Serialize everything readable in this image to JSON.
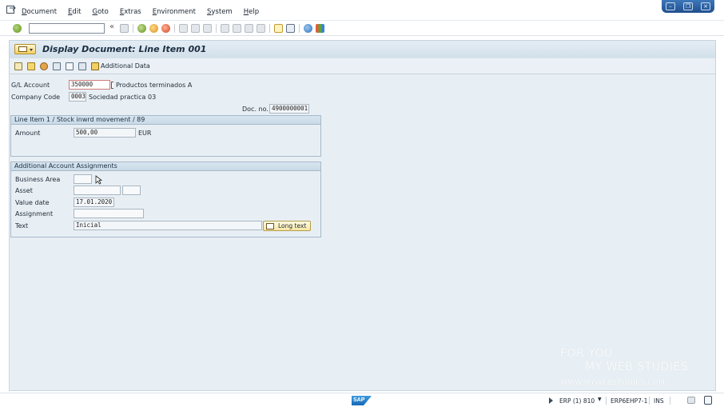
{
  "menu": {
    "items": [
      "Document",
      "Edit",
      "Goto",
      "Extras",
      "Environment",
      "System",
      "Help"
    ]
  },
  "window_controls": [
    "minimize",
    "restore",
    "close"
  ],
  "toolbar": {
    "command_field_value": "",
    "icons": [
      "enter-icon",
      "save-icon",
      "back-icon",
      "exit-icon",
      "cancel-icon",
      "print-icon",
      "find-icon",
      "find-next-icon",
      "first-page-icon",
      "previous-page-icon",
      "next-page-icon",
      "last-page-icon",
      "new-session-icon",
      "shortcut-icon",
      "help-icon",
      "customize-layout-icon"
    ]
  },
  "title": "Display Document: Line Item 001",
  "app_toolbar": {
    "additional_data_label": "Additional Data"
  },
  "header": {
    "gl_account_label": "G/L Account",
    "gl_account_value": "350000",
    "gl_account_text": "Productos terminados A",
    "company_code_label": "Company Code",
    "company_code_value": "0003",
    "company_code_text": "Sociedad practica 03",
    "doc_no_label": "Doc. no.",
    "doc_no_value": "4900000001"
  },
  "line_item_group": {
    "title": "Line Item 1 / Stock inwrd movement / 89",
    "amount_label": "Amount",
    "amount_value": "500,00",
    "currency": "EUR"
  },
  "assignments_group": {
    "title": "Additional Account Assignments",
    "business_area_label": "Business Area",
    "business_area_value": "",
    "asset_label": "Asset",
    "asset_value": "",
    "asset_sub_value": "",
    "value_date_label": "Value date",
    "value_date_value": "17.01.2020",
    "assignment_label": "Assignment",
    "assignment_value": "",
    "text_label": "Text",
    "text_value": "Inicial",
    "long_text_label": "Long text"
  },
  "watermark": {
    "line1": "FOR YOU",
    "line2": "MY WEB STUDIES",
    "line3": "WWW.MYWEBSTUDIES.COM"
  },
  "statusbar": {
    "logo": "SAP",
    "system": "ERP (1) 810",
    "server": "ERP6EHP7-1",
    "mode": "INS"
  },
  "colors": {
    "accent": "#2a6fb7",
    "background": "#e8eff4",
    "title_bar": "#d2e0ea"
  }
}
